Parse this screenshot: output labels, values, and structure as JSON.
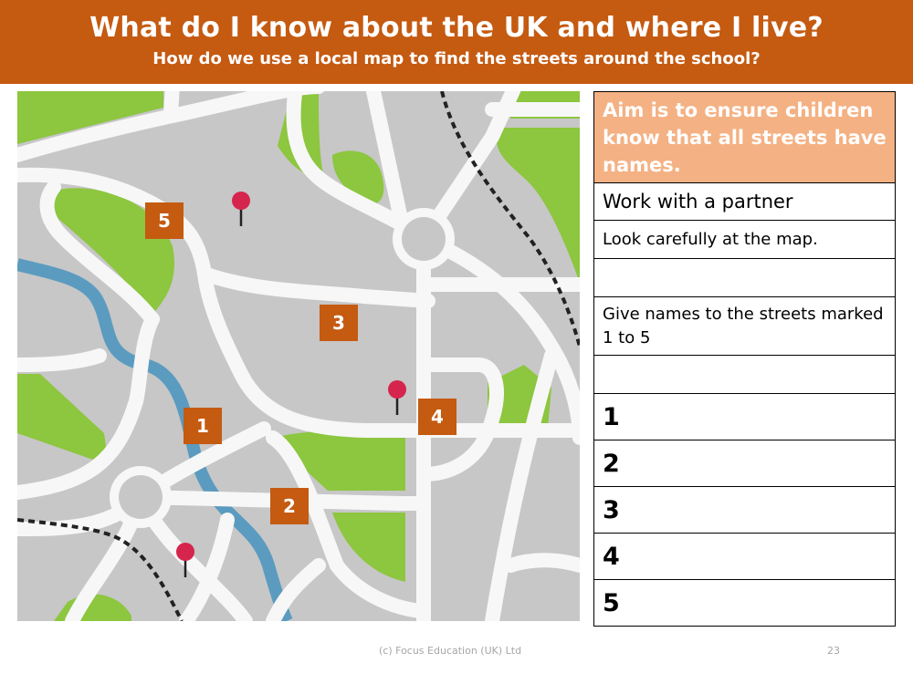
{
  "header": {
    "title": "What do I know about the UK and where I live?",
    "subtitle": "How do we use a local map to find the streets around the school?"
  },
  "map": {
    "description": "Illustrated local street map",
    "colors": {
      "land": "#c7c7c7",
      "road": "#f7f7f7",
      "park": "#8dc63f",
      "river": "#5b9bc0",
      "railway": "#222222",
      "pin": "#d6254d",
      "marker": "#c55a11"
    },
    "markers": [
      {
        "label": "1"
      },
      {
        "label": "2"
      },
      {
        "label": "3"
      },
      {
        "label": "4"
      },
      {
        "label": "5"
      }
    ],
    "pins": [
      {
        "name": "pin-top"
      },
      {
        "name": "pin-middle"
      },
      {
        "name": "pin-bottom"
      }
    ]
  },
  "panel": {
    "aim": "Aim is to ensure children know that all streets have names.",
    "partner": "Work with a partner",
    "look": "Look carefully at the map.",
    "give": "Give names to the streets marked 1 to 5",
    "answers": [
      {
        "number": "1",
        "value": ""
      },
      {
        "number": "2",
        "value": ""
      },
      {
        "number": "3",
        "value": ""
      },
      {
        "number": "4",
        "value": ""
      },
      {
        "number": "5",
        "value": ""
      }
    ]
  },
  "footer": {
    "credit": "(c) Focus Education (UK) Ltd",
    "page_number": "23"
  }
}
